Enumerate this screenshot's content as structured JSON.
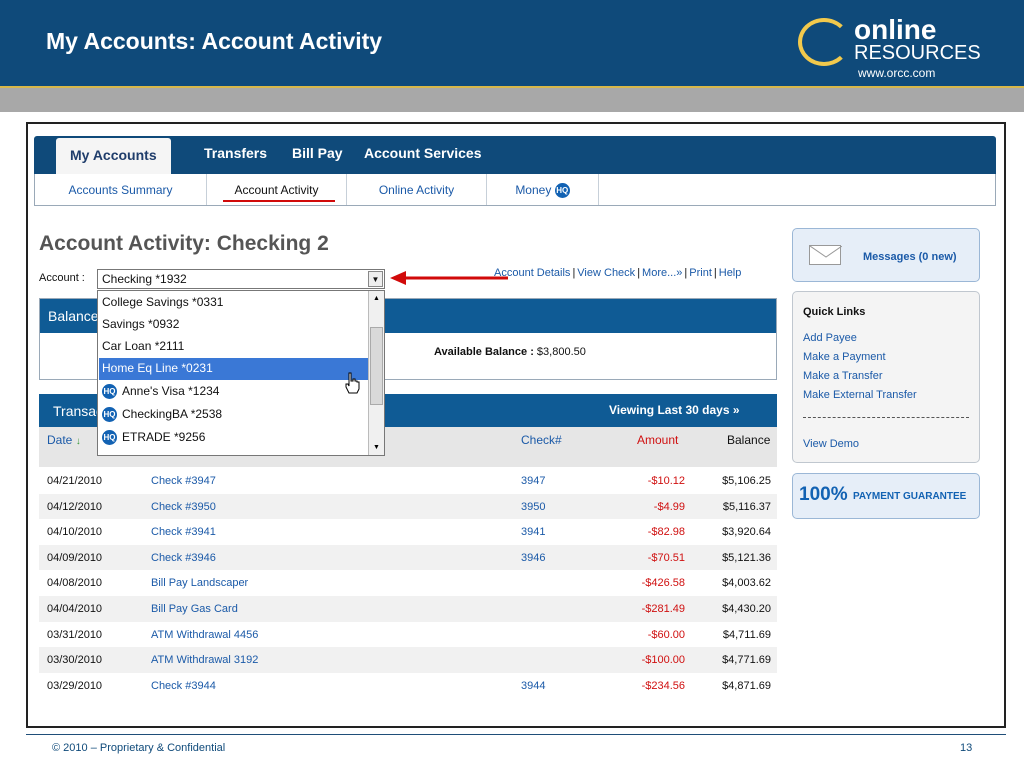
{
  "slide": {
    "title": "My Accounts: Account Activity",
    "logo_online": "online",
    "logo_resources": "RESOURCES",
    "logo_url": "www.orcc.com",
    "footer": "© 2010 – Proprietary & Confidential",
    "page_number": "13"
  },
  "nav": {
    "tabs": [
      {
        "label": "My Accounts"
      },
      {
        "label": "Transfers"
      },
      {
        "label": "Bill Pay"
      },
      {
        "label": "Account Services"
      }
    ],
    "subnav": [
      {
        "label": "Accounts Summary"
      },
      {
        "label": "Account Activity"
      },
      {
        "label": "Online Activity"
      },
      {
        "label": "Money"
      }
    ],
    "hq_badge": "HQ"
  },
  "page": {
    "title": "Account Activity: Checking 2",
    "account_label": "Account :",
    "account_selected": "Checking *1932",
    "links": [
      "Account Details",
      "View Check",
      "More...»",
      "Print",
      "Help"
    ]
  },
  "dropdown": {
    "items": [
      {
        "label": "College Savings *0331",
        "hq": false
      },
      {
        "label": "Savings *0932",
        "hq": false
      },
      {
        "label": "Car Loan *2111",
        "hq": false
      },
      {
        "label": "Home Eq Line *0231",
        "hq": false,
        "selected": true
      },
      {
        "label": "Anne's Visa *1234",
        "hq": true
      },
      {
        "label": "CheckingBA *2538",
        "hq": true
      },
      {
        "label": "ETRADE *9256",
        "hq": true
      }
    ]
  },
  "balance": {
    "title": "Balance",
    "available_label": "Available Balance :",
    "available_value": "$3,800.50"
  },
  "transactions": {
    "title": "Transac",
    "viewing": "Viewing Last 30 days »",
    "columns": {
      "date": "Date",
      "sort_icon": "↓",
      "check": "Check#",
      "amount": "Amount",
      "balance": "Balance"
    },
    "rows": [
      {
        "date": "04/21/2010",
        "desc": "Check #3947",
        "check": "3947",
        "amount": "-$10.12",
        "balance": "$5,106.25"
      },
      {
        "date": "04/12/2010",
        "desc": "Check #3950",
        "check": "3950",
        "amount": "-$4.99",
        "balance": "$5,116.37"
      },
      {
        "date": "04/10/2010",
        "desc": "Check #3941",
        "check": "3941",
        "amount": "-$82.98",
        "balance": "$3,920.64"
      },
      {
        "date": "04/09/2010",
        "desc": "Check #3946",
        "check": "3946",
        "amount": "-$70.51",
        "balance": "$5,121.36"
      },
      {
        "date": "04/08/2010",
        "desc": "Bill Pay Landscaper",
        "check": "",
        "amount": "-$426.58",
        "balance": "$4,003.62"
      },
      {
        "date": "04/04/2010",
        "desc": "Bill Pay Gas Card",
        "check": "",
        "amount": "-$281.49",
        "balance": "$4,430.20"
      },
      {
        "date": "03/31/2010",
        "desc": "ATM Withdrawal 4456",
        "check": "",
        "amount": "-$60.00",
        "balance": "$4,711.69"
      },
      {
        "date": "03/30/2010",
        "desc": "ATM Withdrawal 3192",
        "check": "",
        "amount": "-$100.00",
        "balance": "$4,771.69"
      },
      {
        "date": "03/29/2010",
        "desc": "Check #3944",
        "check": "3944",
        "amount": "-$234.56",
        "balance": "$4,871.69"
      }
    ]
  },
  "sidebar": {
    "messages": "Messages (0 new)",
    "quick_links_title": "Quick Links",
    "quick_links": [
      "Add Payee",
      "Make a Payment",
      "Make a Transfer",
      "Make External Transfer"
    ],
    "view_demo": "View Demo",
    "guarantee_big": "100%",
    "guarantee_text": "PAYMENT GUARANTEE"
  }
}
